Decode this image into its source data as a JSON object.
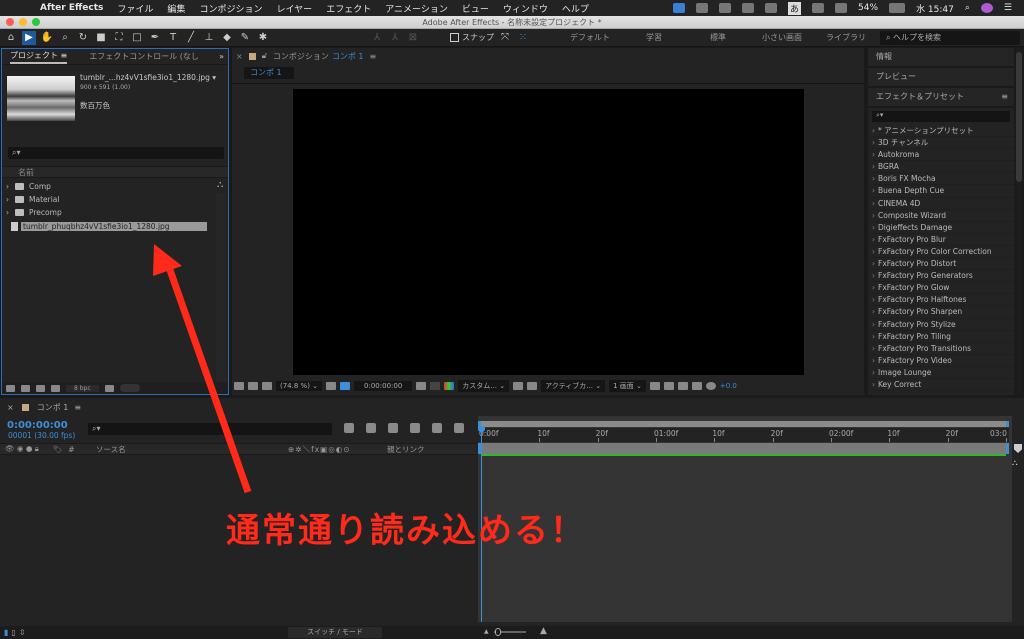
{
  "menubar": {
    "app_name": "After Effects",
    "items": [
      "ファイル",
      "編集",
      "コンポジション",
      "レイヤー",
      "エフェクト",
      "アニメーション",
      "ビュー",
      "ウィンドウ",
      "ヘルプ"
    ],
    "status": {
      "battery": "54%",
      "clock": "水 15:47",
      "ime": "あ"
    }
  },
  "window": {
    "title": "Adobe After Effects - 名称未設定プロジェクト *"
  },
  "toolbar": {
    "snap_label": "スナップ",
    "workspaces": [
      "デフォルト",
      "学習",
      "標準",
      "小さい画面",
      "ライブラリ"
    ],
    "more": "»",
    "help_search_placeholder": "ヘルプを検索"
  },
  "project_panel": {
    "tabs": [
      "プロジェクト ≡",
      "エフェクトコントロール (なし"
    ],
    "more": "»",
    "selected_file": {
      "name": "tumblr_...hz4vV1sfie3io1_1280.jpg ▾",
      "dimensions": "900 x 591 (1.00)",
      "color": "数百万色"
    },
    "search_placeholder": "⌕▾",
    "column_name": "名前",
    "items": [
      {
        "type": "folder",
        "name": "Comp"
      },
      {
        "type": "folder",
        "name": "Material"
      },
      {
        "type": "folder",
        "name": "Precomp"
      },
      {
        "type": "file",
        "name": "tumblr_phuqbhz4vV1sfie3io1_1280.jpg",
        "selected": true
      }
    ],
    "bpc": "8 bpc"
  },
  "composition_panel": {
    "tab_prefix": "コンポジション",
    "comp_name": "コンポ 1",
    "subtab": "コンポ 1",
    "footer": {
      "zoom": "(74.8 %)",
      "timecode": "0:00:00:00",
      "channel": "カスタム...",
      "camera": "アクティブカ...",
      "view": "1 画面",
      "exposure": "+0.0"
    }
  },
  "right_panel": {
    "info": "情報",
    "preview": "プレビュー",
    "effects_title": "エフェクト＆プリセット",
    "search_placeholder": "⌕▾",
    "effects": [
      "* アニメーションプリセット",
      "3D チャンネル",
      "Autokroma",
      "BGRA",
      "Boris FX Mocha",
      "Buena Depth Cue",
      "CINEMA 4D",
      "Composite Wizard",
      "Digieffects Damage",
      "FxFactory Pro Blur",
      "FxFactory Pro Color Correction",
      "FxFactory Pro Distort",
      "FxFactory Pro Generators",
      "FxFactory Pro Glow",
      "FxFactory Pro Halftones",
      "FxFactory Pro Sharpen",
      "FxFactory Pro Stylize",
      "FxFactory Pro Tiling",
      "FxFactory Pro Transitions",
      "FxFactory Pro Video",
      "Image Lounge",
      "Key Correct"
    ]
  },
  "timeline": {
    "tab": "コンポ 1",
    "timecode": "0:00:00:00",
    "frame_fps": "00001 (30.00 fps)",
    "search_placeholder": "⌕▾",
    "columns": {
      "source": "ソース名",
      "switches": "⊕✲＼fx▣◎◐⊙",
      "parent": "親とリンク"
    },
    "ruler": [
      "0:00f",
      "10f",
      "20f",
      "01:00f",
      "10f",
      "20f",
      "02:00f",
      "10f",
      "20f",
      "03:0"
    ],
    "footer_toggle": "スイッチ / モード"
  },
  "annotation": {
    "text": "通常通り読み込める！",
    "color": "#ff2a1a"
  }
}
